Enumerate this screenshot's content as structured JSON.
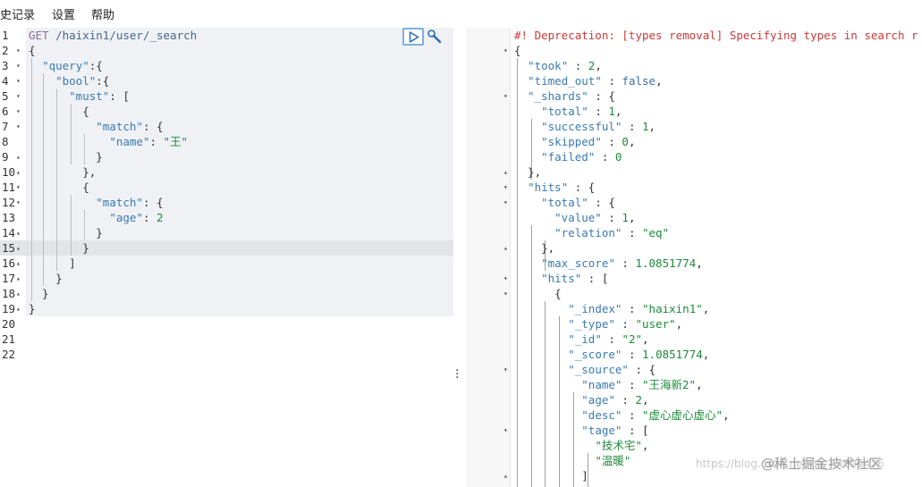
{
  "menu": {
    "history": "史记录",
    "settings": "设置",
    "help": "帮助"
  },
  "request": {
    "lines": [
      {
        "n": "1",
        "f": "",
        "t": [
          [
            "m",
            "GET "
          ],
          [
            "u",
            "/haixin1/user/_search"
          ]
        ]
      },
      {
        "n": "2",
        "f": "▾",
        "t": [
          [
            "p",
            "{"
          ]
        ]
      },
      {
        "n": "3",
        "f": "▾",
        "t": [
          [
            "p",
            "  "
          ],
          [
            "k",
            "\"query\""
          ],
          [
            "p",
            ":{"
          ]
        ]
      },
      {
        "n": "4",
        "f": "▾",
        "t": [
          [
            "p",
            "    "
          ],
          [
            "k",
            "\"bool\""
          ],
          [
            "p",
            ":{"
          ]
        ]
      },
      {
        "n": "5",
        "f": "▾",
        "t": [
          [
            "p",
            "      "
          ],
          [
            "k",
            "\"must\""
          ],
          [
            "p",
            ": ["
          ]
        ]
      },
      {
        "n": "6",
        "f": "▾",
        "t": [
          [
            "p",
            "        {"
          ]
        ]
      },
      {
        "n": "7",
        "f": "▾",
        "t": [
          [
            "p",
            "          "
          ],
          [
            "k",
            "\"match\""
          ],
          [
            "p",
            ": {"
          ]
        ]
      },
      {
        "n": "8",
        "f": "",
        "t": [
          [
            "p",
            "            "
          ],
          [
            "k",
            "\"name\""
          ],
          [
            "p",
            ": "
          ],
          [
            "s",
            "\"王\""
          ]
        ]
      },
      {
        "n": "9",
        "f": "▴",
        "t": [
          [
            "p",
            "          }"
          ]
        ]
      },
      {
        "n": "10",
        "f": "▴",
        "t": [
          [
            "p",
            "        },"
          ]
        ]
      },
      {
        "n": "11",
        "f": "▾",
        "t": [
          [
            "p",
            "        {"
          ]
        ]
      },
      {
        "n": "12",
        "f": "▾",
        "t": [
          [
            "p",
            "          "
          ],
          [
            "k",
            "\"match\""
          ],
          [
            "p",
            ": {"
          ]
        ]
      },
      {
        "n": "13",
        "f": "",
        "t": [
          [
            "p",
            "            "
          ],
          [
            "k",
            "\"age\""
          ],
          [
            "p",
            ": "
          ],
          [
            "n",
            "2"
          ]
        ]
      },
      {
        "n": "14",
        "f": "▴",
        "t": [
          [
            "p",
            "          }"
          ]
        ]
      },
      {
        "n": "15",
        "f": "▴",
        "t": [
          [
            "p",
            "        }"
          ]
        ]
      },
      {
        "n": "16",
        "f": "▴",
        "t": [
          [
            "p",
            "      ]"
          ]
        ]
      },
      {
        "n": "17",
        "f": "▴",
        "t": [
          [
            "p",
            "    }"
          ]
        ]
      },
      {
        "n": "18",
        "f": "▴",
        "t": [
          [
            "p",
            "  }"
          ]
        ]
      },
      {
        "n": "19",
        "f": "▴",
        "t": [
          [
            "p",
            "}"
          ]
        ]
      },
      {
        "n": "20",
        "f": "",
        "t": []
      },
      {
        "n": "21",
        "f": "",
        "t": []
      },
      {
        "n": "22",
        "f": "",
        "t": []
      }
    ]
  },
  "response": {
    "lines": [
      {
        "n": "1",
        "f": "",
        "t": [
          [
            "warn",
            "#! Deprecation: [types removal] Specifying types in search r"
          ]
        ]
      },
      {
        "n": "2",
        "f": "▾",
        "t": [
          [
            "p",
            "{"
          ]
        ]
      },
      {
        "n": "3",
        "f": "",
        "t": [
          [
            "p",
            "  "
          ],
          [
            "k",
            "\"took\""
          ],
          [
            "p",
            " : "
          ],
          [
            "n",
            "2"
          ],
          [
            "p",
            ","
          ]
        ]
      },
      {
        "n": "4",
        "f": "",
        "t": [
          [
            "p",
            "  "
          ],
          [
            "k",
            "\"timed_out\""
          ],
          [
            "p",
            " : "
          ],
          [
            "kw",
            "false"
          ],
          [
            "p",
            ","
          ]
        ]
      },
      {
        "n": "5",
        "f": "▾",
        "t": [
          [
            "p",
            "  "
          ],
          [
            "k",
            "\"_shards\""
          ],
          [
            "p",
            " : {"
          ]
        ]
      },
      {
        "n": "6",
        "f": "",
        "t": [
          [
            "p",
            "    "
          ],
          [
            "k",
            "\"total\""
          ],
          [
            "p",
            " : "
          ],
          [
            "n",
            "1"
          ],
          [
            "p",
            ","
          ]
        ]
      },
      {
        "n": "7",
        "f": "",
        "t": [
          [
            "p",
            "    "
          ],
          [
            "k",
            "\"successful\""
          ],
          [
            "p",
            " : "
          ],
          [
            "n",
            "1"
          ],
          [
            "p",
            ","
          ]
        ]
      },
      {
        "n": "8",
        "f": "",
        "t": [
          [
            "p",
            "    "
          ],
          [
            "k",
            "\"skipped\""
          ],
          [
            "p",
            " : "
          ],
          [
            "n",
            "0"
          ],
          [
            "p",
            ","
          ]
        ]
      },
      {
        "n": "9",
        "f": "",
        "t": [
          [
            "p",
            "    "
          ],
          [
            "k",
            "\"failed\""
          ],
          [
            "p",
            " : "
          ],
          [
            "n",
            "0"
          ]
        ]
      },
      {
        "n": "10",
        "f": "▴",
        "t": [
          [
            "p",
            "  },"
          ]
        ]
      },
      {
        "n": "11",
        "f": "▾",
        "t": [
          [
            "p",
            "  "
          ],
          [
            "k",
            "\"hits\""
          ],
          [
            "p",
            " : {"
          ]
        ]
      },
      {
        "n": "12",
        "f": "▾",
        "t": [
          [
            "p",
            "    "
          ],
          [
            "k",
            "\"total\""
          ],
          [
            "p",
            " : {"
          ]
        ]
      },
      {
        "n": "13",
        "f": "",
        "t": [
          [
            "p",
            "      "
          ],
          [
            "k",
            "\"value\""
          ],
          [
            "p",
            " : "
          ],
          [
            "n",
            "1"
          ],
          [
            "p",
            ","
          ]
        ]
      },
      {
        "n": "14",
        "f": "",
        "t": [
          [
            "p",
            "      "
          ],
          [
            "k",
            "\"relation\""
          ],
          [
            "p",
            " : "
          ],
          [
            "s",
            "\"eq\""
          ]
        ]
      },
      {
        "n": "15",
        "f": "▴",
        "t": [
          [
            "p",
            "    },"
          ]
        ]
      },
      {
        "n": "16",
        "f": "",
        "t": [
          [
            "p",
            "    "
          ],
          [
            "k",
            "\"max_score\""
          ],
          [
            "p",
            " : "
          ],
          [
            "n",
            "1.0851774"
          ],
          [
            "p",
            ","
          ]
        ]
      },
      {
        "n": "17",
        "f": "▾",
        "t": [
          [
            "p",
            "    "
          ],
          [
            "k",
            "\"hits\""
          ],
          [
            "p",
            " : ["
          ]
        ]
      },
      {
        "n": "18",
        "f": "▾",
        "t": [
          [
            "p",
            "      {"
          ]
        ]
      },
      {
        "n": "19",
        "f": "",
        "t": [
          [
            "p",
            "        "
          ],
          [
            "k",
            "\"_index\""
          ],
          [
            "p",
            " : "
          ],
          [
            "s",
            "\"haixin1\""
          ],
          [
            "p",
            ","
          ]
        ]
      },
      {
        "n": "20",
        "f": "",
        "t": [
          [
            "p",
            "        "
          ],
          [
            "k",
            "\"_type\""
          ],
          [
            "p",
            " : "
          ],
          [
            "s",
            "\"user\""
          ],
          [
            "p",
            ","
          ]
        ]
      },
      {
        "n": "21",
        "f": "",
        "t": [
          [
            "p",
            "        "
          ],
          [
            "k",
            "\"_id\""
          ],
          [
            "p",
            " : "
          ],
          [
            "s",
            "\"2\""
          ],
          [
            "p",
            ","
          ]
        ]
      },
      {
        "n": "22",
        "f": "",
        "t": [
          [
            "p",
            "        "
          ],
          [
            "k",
            "\"_score\""
          ],
          [
            "p",
            " : "
          ],
          [
            "n",
            "1.0851774"
          ],
          [
            "p",
            ","
          ]
        ]
      },
      {
        "n": "23",
        "f": "▾",
        "t": [
          [
            "p",
            "        "
          ],
          [
            "k",
            "\"_source\""
          ],
          [
            "p",
            " : {"
          ]
        ]
      },
      {
        "n": "24",
        "f": "",
        "t": [
          [
            "p",
            "          "
          ],
          [
            "k",
            "\"name\""
          ],
          [
            "p",
            " : "
          ],
          [
            "s",
            "\"王海新2\""
          ],
          [
            "p",
            ","
          ]
        ]
      },
      {
        "n": "25",
        "f": "",
        "t": [
          [
            "p",
            "          "
          ],
          [
            "k",
            "\"age\""
          ],
          [
            "p",
            " : "
          ],
          [
            "n",
            "2"
          ],
          [
            "p",
            ","
          ]
        ]
      },
      {
        "n": "26",
        "f": "",
        "t": [
          [
            "p",
            "          "
          ],
          [
            "k",
            "\"desc\""
          ],
          [
            "p",
            " : "
          ],
          [
            "s",
            "\"虚心虚心虚心\""
          ],
          [
            "p",
            ","
          ]
        ]
      },
      {
        "n": "27",
        "f": "▾",
        "t": [
          [
            "p",
            "          "
          ],
          [
            "k",
            "\"tage\""
          ],
          [
            "p",
            " : ["
          ]
        ]
      },
      {
        "n": "28",
        "f": "",
        "t": [
          [
            "p",
            "            "
          ],
          [
            "s",
            "\"技术宅\""
          ],
          [
            "p",
            ","
          ]
        ]
      },
      {
        "n": "29",
        "f": "",
        "t": [
          [
            "p",
            "            "
          ],
          [
            "s",
            "\"温暖\""
          ]
        ]
      },
      {
        "n": "30",
        "f": "▴",
        "t": [
          [
            "p",
            "          ]"
          ]
        ]
      }
    ]
  },
  "watermark": {
    "url": "https://blog.csdn.net/qq_44695426",
    "brand": "@稀土掘金技术社区"
  },
  "icons": {
    "run": "play-icon",
    "settings": "wrench-icon",
    "divider": "drag-handle-icon"
  }
}
